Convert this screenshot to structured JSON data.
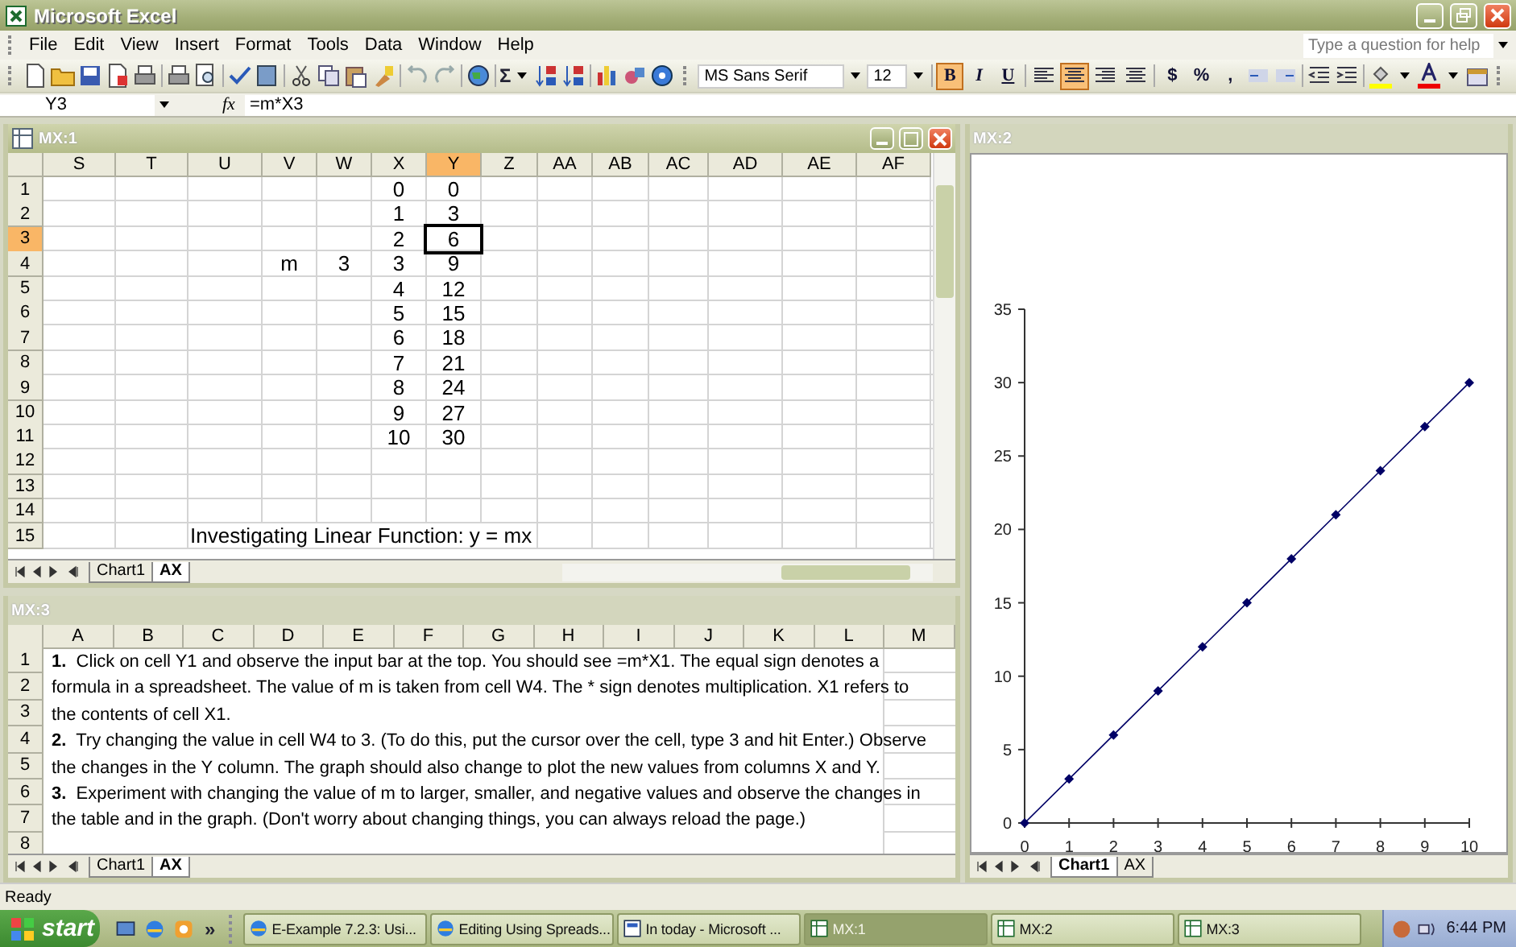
{
  "app_window": {
    "title": "Microsoft Excel"
  },
  "menu": [
    "File",
    "Edit",
    "View",
    "Insert",
    "Format",
    "Tools",
    "Data",
    "Window",
    "Help"
  ],
  "help_box": {
    "placeholder": "Type a question for help"
  },
  "standard_toolbar": {
    "autosum": "Σ"
  },
  "formatting_toolbar": {
    "font": "MS Sans Serif",
    "size": "12",
    "styles": [
      {
        "label": "B",
        "selected": true
      },
      {
        "label": "I",
        "selected": false
      },
      {
        "label": "U",
        "selected": false
      }
    ],
    "alignments": [
      {
        "selected": false
      },
      {
        "selected": true
      },
      {
        "selected": false
      },
      {
        "selected": false
      }
    ],
    "number_formats": [
      "$",
      "%",
      ","
    ]
  },
  "formula_bar": {
    "name_box": "Y3",
    "fx_label": "fx",
    "formula": "=m*X3"
  },
  "sheet_window": {
    "title": "MX:1",
    "active": true,
    "columns": [
      {
        "label": "S",
        "selected": false
      },
      {
        "label": "T",
        "selected": false
      },
      {
        "label": "U",
        "selected": false
      },
      {
        "label": "V",
        "selected": false
      },
      {
        "label": "W",
        "selected": false
      },
      {
        "label": "X",
        "selected": false
      },
      {
        "label": "Y",
        "selected": true
      },
      {
        "label": "Z",
        "selected": false
      },
      {
        "label": "AA",
        "selected": false
      },
      {
        "label": "AB",
        "selected": false
      },
      {
        "label": "AC",
        "selected": false
      },
      {
        "label": "AD",
        "selected": false
      },
      {
        "label": "AE",
        "selected": false
      },
      {
        "label": "AF",
        "selected": false
      }
    ],
    "rows": [
      {
        "number": "1",
        "selected": false,
        "cells": [
          null,
          null,
          null,
          null,
          null,
          "0",
          "0"
        ]
      },
      {
        "number": "2",
        "selected": false,
        "cells": [
          null,
          null,
          null,
          null,
          null,
          "1",
          "3"
        ]
      },
      {
        "number": "3",
        "selected": true,
        "cells": [
          null,
          null,
          null,
          null,
          null,
          "2",
          "6"
        ]
      },
      {
        "number": "4",
        "selected": false,
        "cells": [
          null,
          null,
          null,
          "m",
          "3",
          "3",
          "9"
        ]
      },
      {
        "number": "5",
        "selected": false,
        "cells": [
          null,
          null,
          null,
          null,
          null,
          "4",
          "12"
        ]
      },
      {
        "number": "6",
        "selected": false,
        "cells": [
          null,
          null,
          null,
          null,
          null,
          "5",
          "15"
        ]
      },
      {
        "number": "7",
        "selected": false,
        "cells": [
          null,
          null,
          null,
          null,
          null,
          "6",
          "18"
        ]
      },
      {
        "number": "8",
        "selected": false,
        "cells": [
          null,
          null,
          null,
          null,
          null,
          "7",
          "21"
        ]
      },
      {
        "number": "9",
        "selected": false,
        "cells": [
          null,
          null,
          null,
          null,
          null,
          "8",
          "24"
        ]
      },
      {
        "number": "10",
        "selected": false,
        "cells": [
          null,
          null,
          null,
          null,
          null,
          "9",
          "27"
        ]
      },
      {
        "number": "11",
        "selected": false,
        "cells": [
          null,
          null,
          null,
          null,
          null,
          "10",
          "30"
        ]
      },
      {
        "number": "12",
        "selected": false
      },
      {
        "number": "13",
        "selected": false
      },
      {
        "number": "14",
        "selected": false
      },
      {
        "number": "15",
        "selected": false,
        "cells": [
          null,
          null,
          "Investigating Linear Function: y = mx"
        ]
      }
    ],
    "tabs": [
      {
        "label": "Chart1",
        "selected": false
      },
      {
        "label": "AX",
        "selected": true
      }
    ]
  },
  "chart_window": {
    "title": "MX:2",
    "active": false,
    "chart_data": {
      "type": "line",
      "x": [
        0,
        1,
        2,
        3,
        4,
        5,
        6,
        7,
        8,
        9,
        10
      ],
      "series": [
        {
          "color": "#000066",
          "marker": "diamond",
          "values": [
            0,
            3,
            6,
            9,
            12,
            15,
            18,
            21,
            24,
            27,
            30
          ]
        }
      ],
      "xlim": [
        0,
        10
      ],
      "ylim": [
        0,
        35
      ],
      "xticks": [
        0,
        1,
        2,
        3,
        4,
        5,
        6,
        7,
        8,
        9,
        10
      ],
      "yticks": [
        0,
        5,
        10,
        15,
        20,
        25,
        30,
        35
      ]
    },
    "tabs": [
      {
        "label": "Chart1",
        "selected": true
      },
      {
        "label": "AX",
        "selected": false
      }
    ]
  },
  "instructions_window": {
    "title": "MX:3",
    "active": false,
    "columns": [
      "A",
      "B",
      "C",
      "D",
      "E",
      "F",
      "G",
      "H",
      "I",
      "J",
      "K",
      "L",
      "M"
    ],
    "rows": [
      "1",
      "2",
      "3",
      "4",
      "5",
      "6",
      "7",
      "8"
    ],
    "items": [
      {
        "number": "1.",
        "text": "Click on cell Y1 and observe the input bar at the top. You should see =m*X1. The equal sign denotes a formula in a spreadsheet.  The value of m is taken from cell W4. The * sign denotes multiplication. X1 refers to the contents of cell X1."
      },
      {
        "number": "2.",
        "text": "Try changing the value in cell W4 to 3. (To do this, put the cursor over the cell, type 3 and hit Enter.)  Observe the changes in the Y column. The graph should also change to plot the new values from columns X and Y."
      },
      {
        "number": "3.",
        "text": "Experiment with changing the value of m to larger, smaller, and negative values and observe the changes in the table and in the graph. (Don't worry about changing things, you can always reload the page.)"
      }
    ],
    "tabs": [
      {
        "label": "Chart1",
        "selected": false
      },
      {
        "label": "AX",
        "selected": true
      }
    ]
  },
  "status_bar": {
    "text": "Ready"
  },
  "taskbar": {
    "start": "start",
    "overflow": "»",
    "tasks": [
      {
        "label": "E-Example 7.2.3: Usi...",
        "kind": "browser",
        "selected": false
      },
      {
        "label": "Editing Using Spreads...",
        "kind": "browser",
        "selected": false
      },
      {
        "label": "In today - Microsoft ...",
        "kind": "document",
        "selected": false
      },
      {
        "label": "MX:1",
        "kind": "spreadsheet",
        "selected": true
      },
      {
        "label": "MX:2",
        "kind": "spreadsheet",
        "selected": false
      },
      {
        "label": "MX:3",
        "kind": "spreadsheet",
        "selected": false
      }
    ],
    "clock": "6:44 PM"
  }
}
